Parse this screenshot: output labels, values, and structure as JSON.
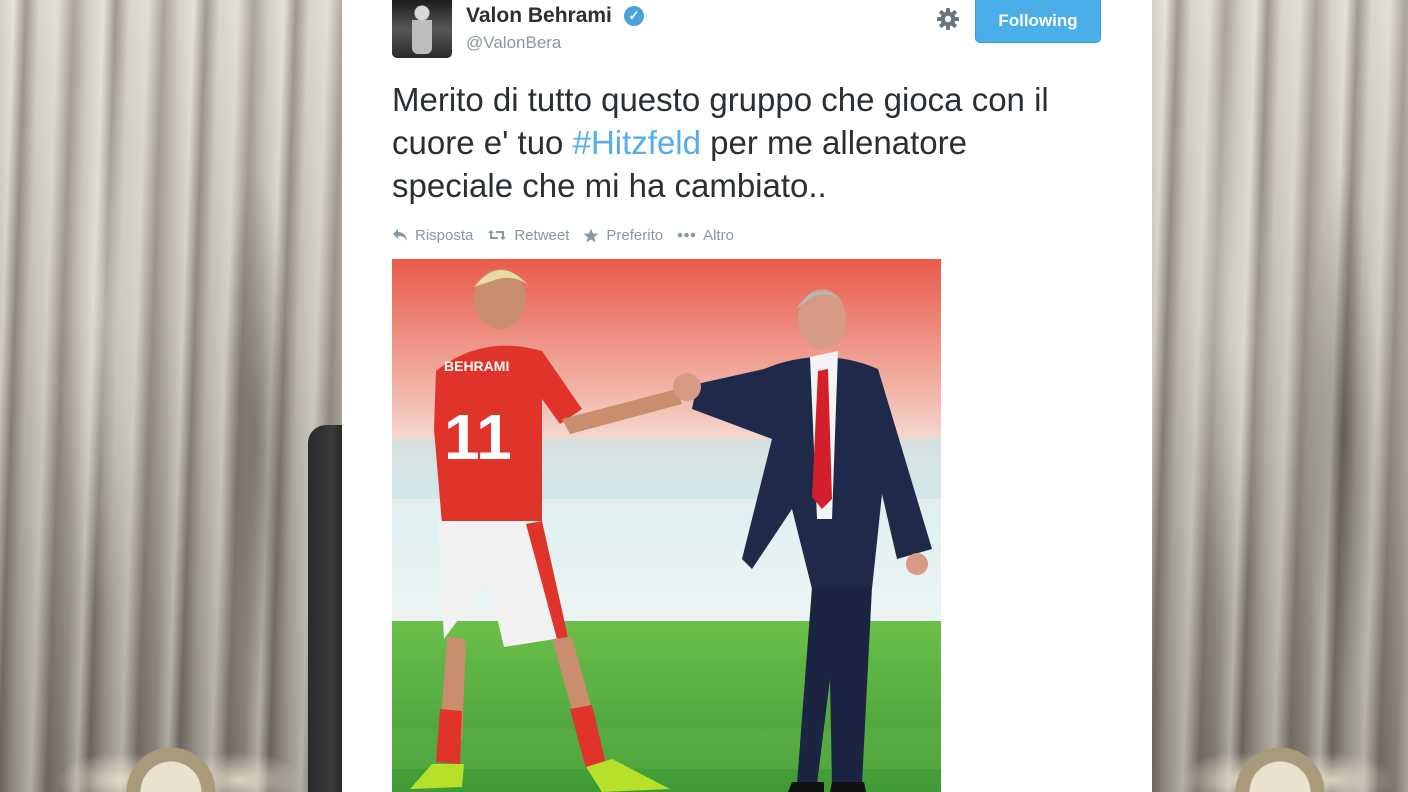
{
  "tweet": {
    "author_name": "Valon Behrami",
    "author_handle": "@ValonBera",
    "follow_label": "Following",
    "text_before": "Merito di tutto questo gruppo che gioca con il cuore e' tuo ",
    "hashtag": "#Hitzfeld",
    "text_after": " per me allenatore speciale che mi ha cambiato..",
    "actions": {
      "reply": "Risposta",
      "retweet": "Retweet",
      "favorite": "Preferito",
      "more": "Altro"
    },
    "photo": {
      "jersey_name": "BEHRAMI",
      "jersey_number": "11"
    }
  },
  "colors": {
    "accent": "#55acee",
    "follow_button": "#4aaee8",
    "text": "#292f33",
    "muted": "#8899a6"
  }
}
